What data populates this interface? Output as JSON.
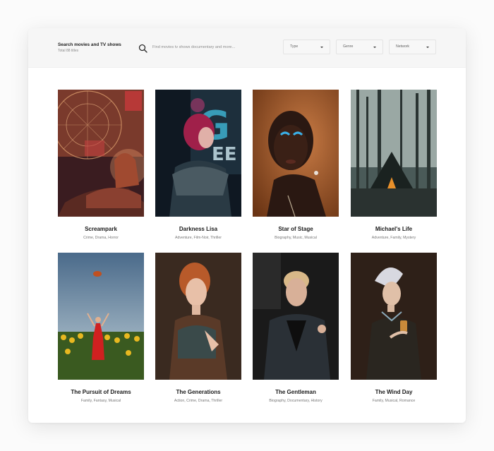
{
  "header": {
    "title": "Search movies and TV shows",
    "subtitle": "Total 88 titles",
    "search": {
      "placeholder": "Find movies tv shows documentary and more..."
    },
    "filters": [
      {
        "label": "Type"
      },
      {
        "label": "Genre"
      },
      {
        "label": "Network"
      }
    ]
  },
  "movies": [
    {
      "title": "Screampark",
      "genres": "Crime, Drama, Horror",
      "poster_icon": "ferris-wheel-woman-poster"
    },
    {
      "title": "Darkness Lisa",
      "genres": "Adventure, Film-Noir, Thriller",
      "poster_icon": "neon-sign-woman-poster"
    },
    {
      "title": "Star of Stage",
      "genres": "Biography, Music, Musical",
      "poster_icon": "portrait-woman-earrings-poster"
    },
    {
      "title": "Michael's Life",
      "genres": "Adventure, Family, Mystery",
      "poster_icon": "forest-tent-poster"
    },
    {
      "title": "The Pursuit of Dreams",
      "genres": "Family, Fantasy, Musical",
      "poster_icon": "sunflower-field-poster"
    },
    {
      "title": "The Generations",
      "genres": "Action, Crime, Drama, Thriller",
      "poster_icon": "red-hair-woman-poster"
    },
    {
      "title": "The Gentleman",
      "genres": "Biography, Documentary, History",
      "poster_icon": "man-dark-jacket-poster"
    },
    {
      "title": "The Wind Day",
      "genres": "Family, Musical, Romance",
      "poster_icon": "woman-headscarf-cup-poster"
    }
  ],
  "colors": {
    "accent": "#222222",
    "topbar": "#f6f6f6",
    "muted": "#777777"
  }
}
